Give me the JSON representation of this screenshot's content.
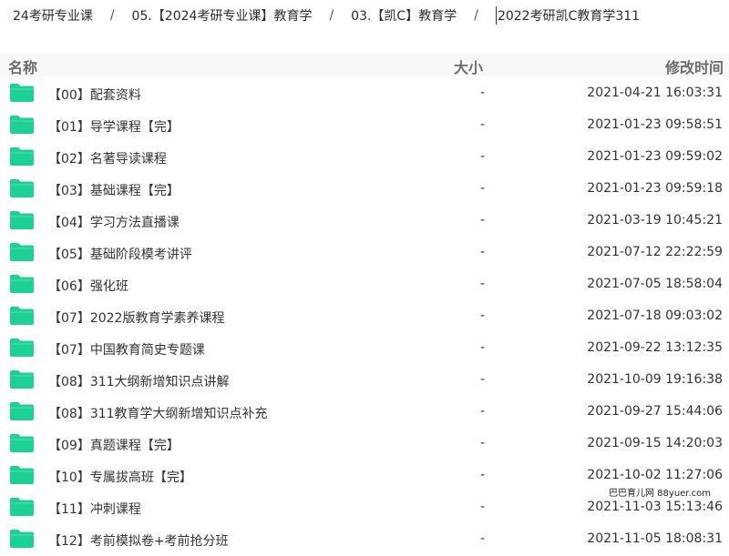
{
  "breadcrumb": {
    "items": [
      "24考研专业课",
      "05.【2024考研专业课】教育学",
      "03.【凯C】教育学"
    ],
    "separator": "/",
    "current": "2022考研凯C教育学311"
  },
  "header": {
    "name": "名称",
    "size": "大小",
    "modified": "修改时间"
  },
  "folder_color": "#1dd195",
  "files": [
    {
      "name": "【00】配套资料",
      "size": "-",
      "modified": "2021-04-21 16:03:31"
    },
    {
      "name": "【01】导学课程【完】",
      "size": "-",
      "modified": "2021-01-23 09:58:51"
    },
    {
      "name": "【02】名著导读课程",
      "size": "-",
      "modified": "2021-01-23 09:59:02"
    },
    {
      "name": "【03】基础课程【完】",
      "size": "-",
      "modified": "2021-01-23 09:59:18"
    },
    {
      "name": "【04】学习方法直播课",
      "size": "-",
      "modified": "2021-03-19 10:45:21"
    },
    {
      "name": "【05】基础阶段模考讲评",
      "size": "-",
      "modified": "2021-07-12 22:22:59"
    },
    {
      "name": "【06】强化班",
      "size": "-",
      "modified": "2021-07-05 18:58:04"
    },
    {
      "name": "【07】2022版教育学素养课程",
      "size": "-",
      "modified": "2021-07-18 09:03:02"
    },
    {
      "name": "【07】中国教育简史专题课",
      "size": "-",
      "modified": "2021-09-22 13:12:35"
    },
    {
      "name": "【08】311大纲新增知识点讲解",
      "size": "-",
      "modified": "2021-10-09 19:16:38"
    },
    {
      "name": "【08】311教育学大纲新增知识点补充",
      "size": "-",
      "modified": "2021-09-27 15:44:06"
    },
    {
      "name": "【09】真题课程【完】",
      "size": "-",
      "modified": "2021-09-15 14:20:03"
    },
    {
      "name": "【10】专属拔高班【完】",
      "size": "-",
      "modified": "2021-10-02 11:27:06"
    },
    {
      "name": "【11】冲刺课程",
      "size": "-",
      "modified": "2021-11-03 15:13:46"
    },
    {
      "name": "【12】考前模拟卷+考前抢分班",
      "size": "-",
      "modified": "2021-11-05 18:08:31"
    }
  ],
  "watermark": "巴巴育儿网 88yuer.com"
}
